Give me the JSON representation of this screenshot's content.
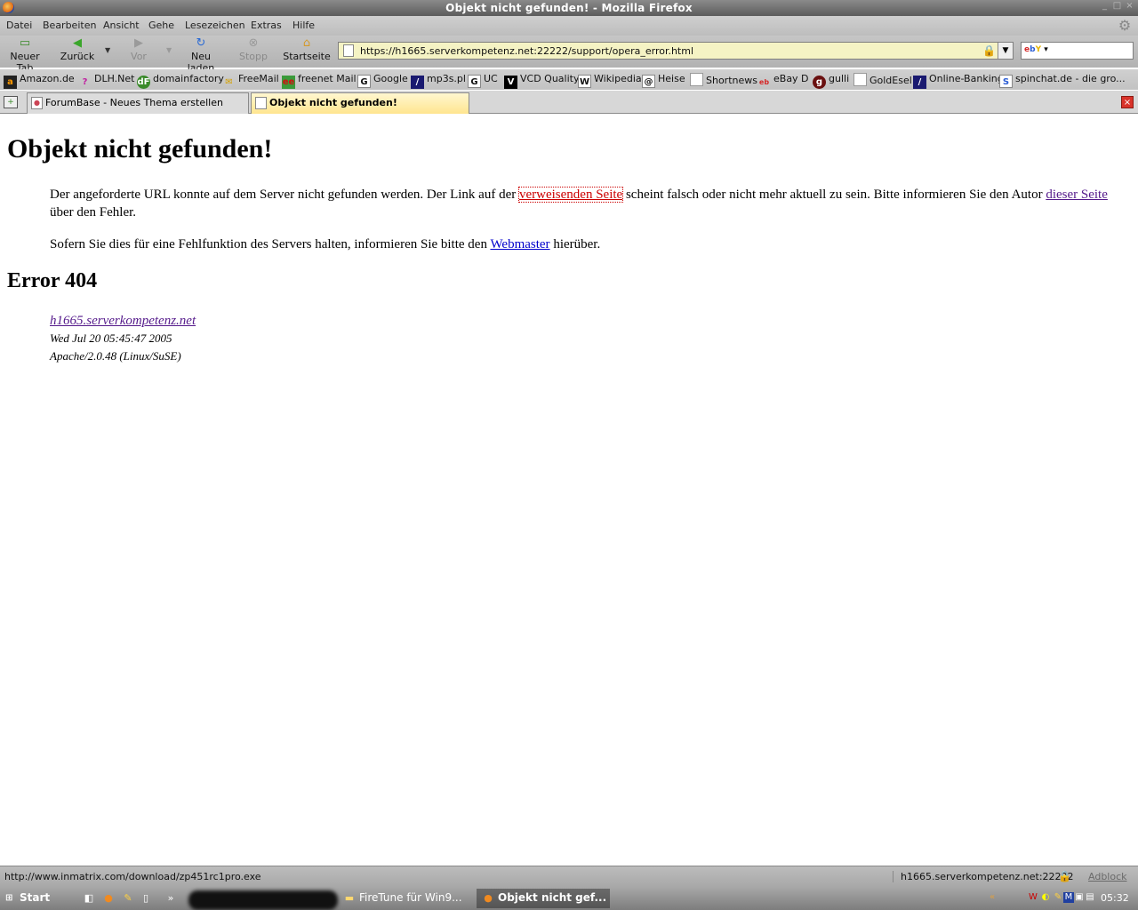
{
  "window": {
    "title": "Objekt nicht gefunden! - Mozilla Firefox"
  },
  "menu": {
    "items": [
      {
        "label": "Datei"
      },
      {
        "label": "Bearbeiten"
      },
      {
        "label": "Ansicht"
      },
      {
        "label": "Gehe"
      },
      {
        "label": "Lesezeichen"
      },
      {
        "label": "Extras"
      },
      {
        "label": "Hilfe"
      }
    ]
  },
  "toolbar": {
    "new_tab": "Neuer Tab",
    "back": "Zurück",
    "forward": "Vor",
    "reload": "Neu laden",
    "stop": "Stopp",
    "home": "Startseite"
  },
  "address": {
    "url": "https://h1665.serverkompetenz.net:22222/support/opera_error.html"
  },
  "search": {
    "engine": "eBay"
  },
  "bookmarks": [
    {
      "label": "Amazon.de",
      "icon": "amazon-icon"
    },
    {
      "label": "DLH.Net",
      "icon": "dlh-icon"
    },
    {
      "label": "domainfactory",
      "icon": "domainfactory-icon"
    },
    {
      "label": "FreeMail",
      "icon": "freemail-icon"
    },
    {
      "label": "freenet Mail",
      "icon": "freenet-icon"
    },
    {
      "label": "Google",
      "icon": "google-icon"
    },
    {
      "label": "mp3s.pl",
      "icon": "mp3s-icon"
    },
    {
      "label": "UC",
      "icon": "uc-icon"
    },
    {
      "label": "VCD Quality",
      "icon": "vcd-icon"
    },
    {
      "label": "Wikipedia",
      "icon": "wikipedia-icon"
    },
    {
      "label": "Heise",
      "icon": "heise-icon"
    },
    {
      "label": "Shortnews",
      "icon": "page-icon"
    },
    {
      "label": "eBay D",
      "icon": "ebay-icon"
    },
    {
      "label": "gulli",
      "icon": "gulli-icon"
    },
    {
      "label": "GoldEsel",
      "icon": "page-icon"
    },
    {
      "label": "Online-Banking",
      "icon": "bank-icon"
    },
    {
      "label": "spinchat.de - die gro...",
      "icon": "spinchat-icon"
    }
  ],
  "tabs": [
    {
      "label": "ForumBase - Neues Thema erstellen",
      "active": false
    },
    {
      "label": "Objekt nicht gefunden!",
      "active": true
    }
  ],
  "page": {
    "heading": "Objekt nicht gefunden!",
    "p1_before": "Der angeforderte URL konnte auf dem Server nicht gefunden werden. Der Link auf der ",
    "p1_link1": "verweisenden Seite",
    "p1_middle": " scheint falsch oder nicht mehr aktuell zu sein. Bitte informieren Sie den Autor ",
    "p1_link2": "dieser Seite",
    "p1_after": " über den Fehler.",
    "p2_before": "Sofern Sie dies für eine Fehlfunktion des Servers halten, informieren Sie bitte den ",
    "p2_link": "Webmaster",
    "p2_after": " hierüber.",
    "error_heading": "Error 404",
    "address_host": "h1665.serverkompetenz.net",
    "address_date": "Wed Jul 20 05:45:47 2005",
    "address_server": "Apache/2.0.48 (Linux/SuSE)"
  },
  "status": {
    "text": "http://www.inmatrix.com/download/zp451rc1pro.exe",
    "host": "h1665.serverkompetenz.net:22222",
    "adblock": "Adblock"
  },
  "taskbar": {
    "start": "Start",
    "tasks": [
      {
        "label": "FireTune für Win9...",
        "icon": "folder-icon",
        "active": false
      },
      {
        "label": "Objekt nicht gef...",
        "icon": "firefox-icon",
        "active": true
      }
    ],
    "clock": "05:32"
  }
}
